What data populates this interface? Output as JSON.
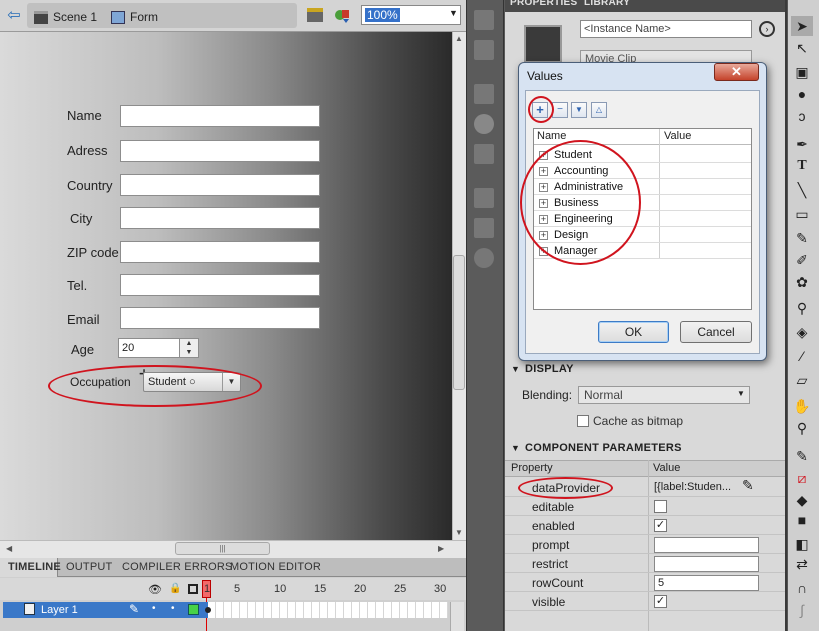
{
  "header": {
    "breadcrumb_scene": "Scene 1",
    "breadcrumb_symbol": "Form",
    "zoom": "100%"
  },
  "form": {
    "fields": [
      {
        "label": "Name"
      },
      {
        "label": "Adress"
      },
      {
        "label": "Country"
      },
      {
        "label": "City"
      },
      {
        "label": "ZIP code"
      },
      {
        "label": "Tel."
      },
      {
        "label": "Email"
      }
    ],
    "age_label": "Age",
    "age_value": "20",
    "occupation_label": "Occupation",
    "occupation_value": "Student"
  },
  "timeline": {
    "tabs": [
      "TIMELINE",
      "OUTPUT",
      "COMPILER ERRORS",
      "MOTION EDITOR"
    ],
    "frame_numbers": [
      "1",
      "5",
      "10",
      "15",
      "20",
      "25",
      "30"
    ],
    "layer_name": "Layer 1"
  },
  "properties": {
    "tabs": [
      "PROPERTIES",
      "LIBRARY"
    ],
    "instance_name_placeholder": "<Instance Name>",
    "symbol_type": "Movie Clip",
    "display_section": "DISPLAY",
    "blending_label": "Blending:",
    "blending_value": "Normal",
    "cache_label": "Cache as bitmap",
    "component_section": "COMPONENT PARAMETERS",
    "col_property": "Property",
    "col_value": "Value",
    "params": [
      {
        "name": "dataProvider",
        "value": "[{label:Studen..."
      },
      {
        "name": "editable",
        "checked": false
      },
      {
        "name": "enabled",
        "checked": true
      },
      {
        "name": "prompt",
        "value": ""
      },
      {
        "name": "restrict",
        "value": ""
      },
      {
        "name": "rowCount",
        "value": "5"
      },
      {
        "name": "visible",
        "checked": true
      }
    ]
  },
  "dialog": {
    "title": "Values",
    "close": "✕",
    "col_name": "Name",
    "col_value": "Value",
    "rows": [
      "Student",
      "Accounting",
      "Administrative",
      "Business",
      "Engineering",
      "Design",
      "Manager"
    ],
    "ok": "OK",
    "cancel": "Cancel"
  },
  "colors": {
    "annotation": "#d0141e",
    "selection": "#3a78c8"
  }
}
